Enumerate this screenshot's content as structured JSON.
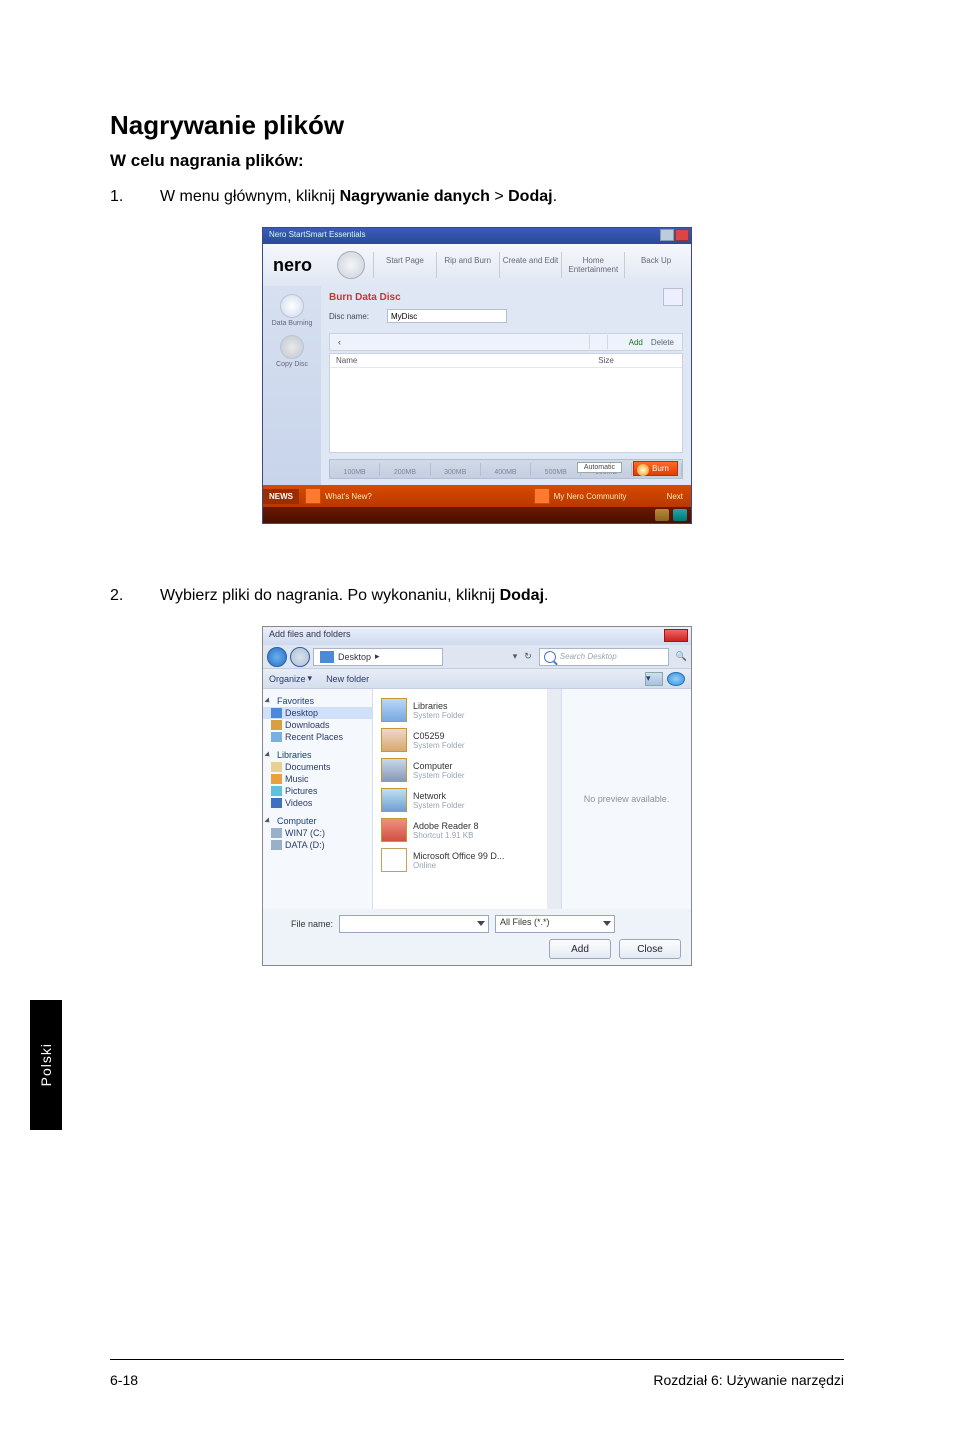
{
  "sideTab": "Polski",
  "heading": "Nagrywanie plików",
  "subheading": "W celu nagrania plików:",
  "steps": [
    {
      "num": "1.",
      "pre": "W menu głównym, kliknij ",
      "b1": "Nagrywanie danych",
      "mid": " > ",
      "b2": "Dodaj",
      "post": "."
    },
    {
      "num": "2.",
      "pre": "Wybierz pliki do nagrania. Po wykonaniu, kliknij ",
      "b1": "Dodaj",
      "mid": "",
      "b2": "",
      "post": "."
    }
  ],
  "shot1": {
    "title": "Nero StartSmart Essentials",
    "logo": "nero",
    "tabs": {
      "t1": "Start Page",
      "t2": "Rip and Burn",
      "t3": "Create and Edit",
      "t4": "Home Entertainment",
      "t5": "Back Up"
    },
    "sidebar": {
      "s1": "Data Burning",
      "s2": "Copy Disc"
    },
    "panelTitle": "Burn Data Disc",
    "discNameLabel": "Disc name:",
    "discNameValue": "MyDisc",
    "toolbar": {
      "add": "Add",
      "delete": "Delete"
    },
    "columnName": "Name",
    "columnSize": "Size",
    "capacityDropdown": "Automatic",
    "burn": "Burn",
    "newsLabel": "NEWS",
    "news1": "What's New?",
    "news2": "My Nero Community",
    "newsNext": "Next"
  },
  "shot2": {
    "title": "Add files and folders",
    "breadcrumb": "Desktop",
    "searchPlaceholder": "Search Desktop",
    "organize": "Organize",
    "newFolder": "New folder",
    "tree": {
      "favorites": "Favorites",
      "desktop": "Desktop",
      "downloads": "Downloads",
      "recent": "Recent Places",
      "libraries": "Libraries",
      "documents": "Documents",
      "music": "Music",
      "pictures": "Pictures",
      "videos": "Videos",
      "computer": "Computer",
      "cdrive": "WIN7 (C:)",
      "ddrive": "DATA (D:)"
    },
    "files": {
      "f1": {
        "name": "Libraries",
        "sub": "System Folder"
      },
      "f2": {
        "name": "C05259",
        "sub": "System Folder"
      },
      "f3": {
        "name": "Computer",
        "sub": "System Folder"
      },
      "f4": {
        "name": "Network",
        "sub": "System Folder"
      },
      "f5": {
        "name": "Adobe Reader 8",
        "sub": "Shortcut\n1.91 KB"
      },
      "f6": {
        "name": "Microsoft Office 99 D...",
        "sub": "Online"
      }
    },
    "preview": "No preview available.",
    "fileNameLabel": "File name:",
    "fileNameValue": "",
    "filterValue": "All Files (*.*)",
    "addBtn": "Add",
    "closeBtn": "Close"
  },
  "footer": {
    "left": "6-18",
    "right": "Rozdział 6: Używanie narzędzi"
  }
}
